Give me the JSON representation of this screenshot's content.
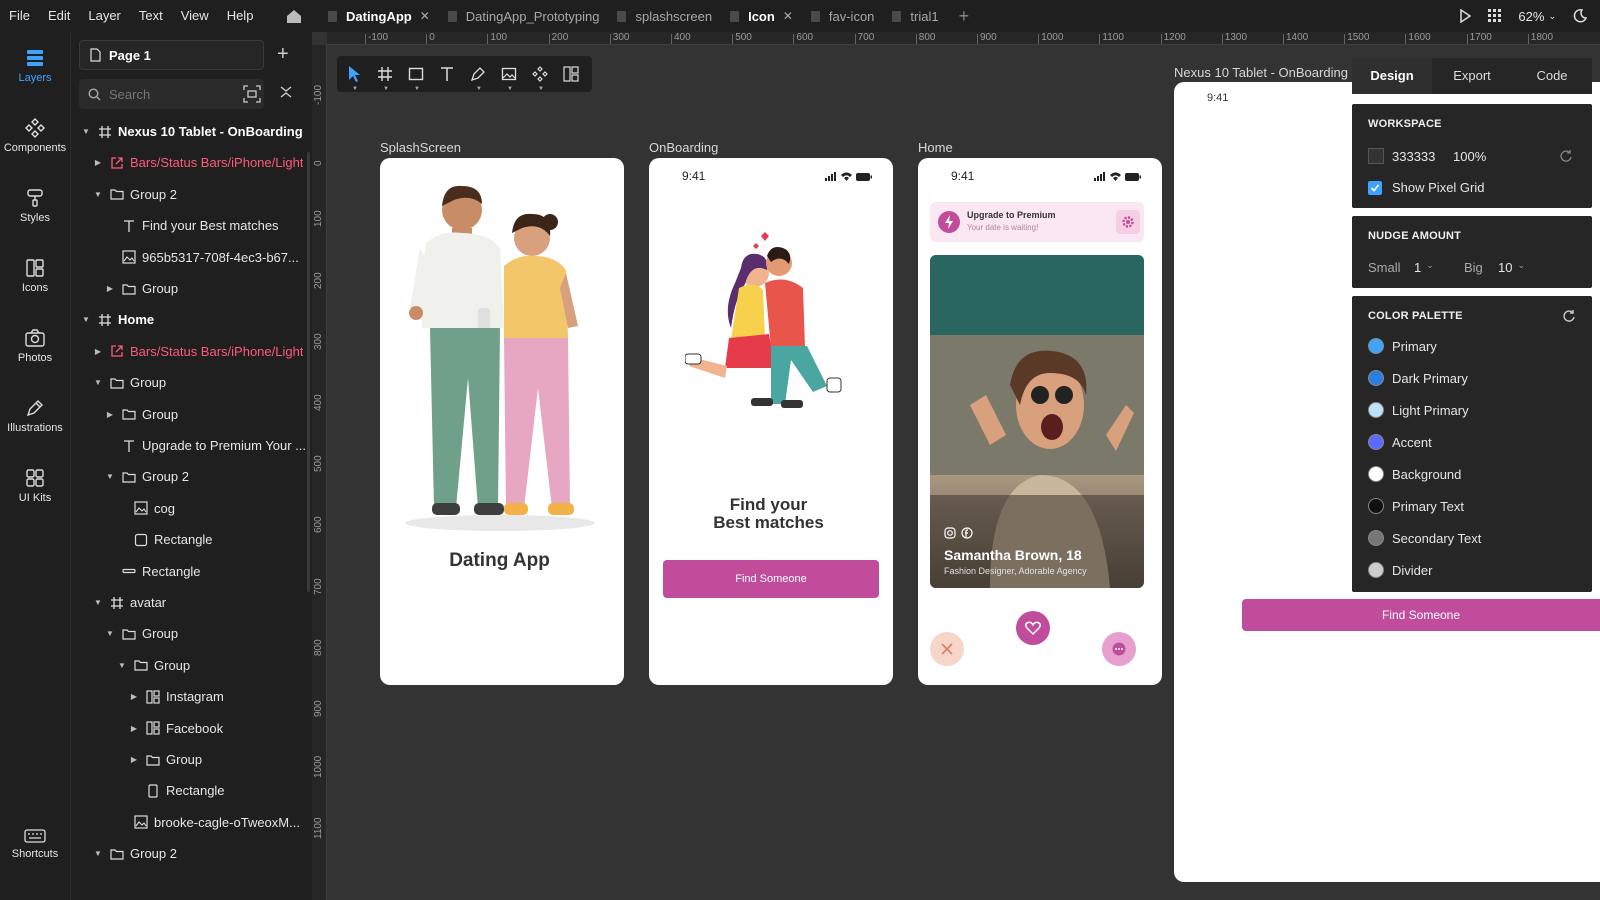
{
  "menu": [
    "File",
    "Edit",
    "Layer",
    "Text",
    "View",
    "Help"
  ],
  "tabs": [
    {
      "label": "DatingApp",
      "active": true,
      "closable": true
    },
    {
      "label": "DatingApp_Prototyping",
      "active": false,
      "closable": false
    },
    {
      "label": "splashscreen",
      "active": false,
      "closable": false
    },
    {
      "label": "Icon",
      "active": true,
      "closable": true
    },
    {
      "label": "fav-icon",
      "active": false,
      "closable": false
    },
    {
      "label": "trial1",
      "active": false,
      "closable": false
    }
  ],
  "zoom": "62%",
  "nav": [
    {
      "label": "Layers",
      "icon": "layers-icon"
    },
    {
      "label": "Components",
      "icon": "components-icon"
    },
    {
      "label": "Styles",
      "icon": "styles-icon"
    },
    {
      "label": "Icons",
      "icon": "icons-icon"
    },
    {
      "label": "Photos",
      "icon": "photos-icon"
    },
    {
      "label": "Illustrations",
      "icon": "illustrations-icon"
    },
    {
      "label": "UI Kits",
      "icon": "ui-kits-icon"
    }
  ],
  "shortcuts_label": "Shortcuts",
  "page_name": "Page 1",
  "search_placeholder": "Search",
  "layers": [
    {
      "name": "Nexus 10 Tablet - OnBoarding",
      "type": "frame",
      "depth": 0,
      "caret": "down"
    },
    {
      "name": "Bars/Status Bars/iPhone/Light",
      "type": "component",
      "depth": 1,
      "caret": "right"
    },
    {
      "name": "Group 2",
      "type": "group",
      "depth": 1,
      "caret": "down"
    },
    {
      "name": "Find your Best matches",
      "type": "text",
      "depth": 2,
      "caret": ""
    },
    {
      "name": "965b5317-708f-4ec3-b67...",
      "type": "image",
      "depth": 2,
      "caret": ""
    },
    {
      "name": "Group",
      "type": "group",
      "depth": 2,
      "caret": "right"
    },
    {
      "name": "Home",
      "type": "frame",
      "depth": 0,
      "caret": "down"
    },
    {
      "name": "Bars/Status Bars/iPhone/Light",
      "type": "component",
      "depth": 1,
      "caret": "right"
    },
    {
      "name": "Group",
      "type": "group",
      "depth": 1,
      "caret": "down"
    },
    {
      "name": "Group",
      "type": "group",
      "depth": 2,
      "caret": "right"
    },
    {
      "name": "Upgrade to Premium Your ...",
      "type": "text",
      "depth": 2,
      "caret": ""
    },
    {
      "name": "Group 2",
      "type": "group",
      "depth": 2,
      "caret": "down"
    },
    {
      "name": "cog",
      "type": "image",
      "depth": 3,
      "caret": ""
    },
    {
      "name": "Rectangle",
      "type": "rect",
      "depth": 3,
      "caret": ""
    },
    {
      "name": "Rectangle",
      "type": "line",
      "depth": 2,
      "caret": ""
    },
    {
      "name": "avatar",
      "type": "frame-normal",
      "depth": 1,
      "caret": "down"
    },
    {
      "name": "Group",
      "type": "group",
      "depth": 2,
      "caret": "down"
    },
    {
      "name": "Group",
      "type": "group",
      "depth": 3,
      "caret": "down"
    },
    {
      "name": "Instagram",
      "type": "component-normal",
      "depth": 4,
      "caret": "right"
    },
    {
      "name": "Facebook",
      "type": "component-normal",
      "depth": 4,
      "caret": "right"
    },
    {
      "name": "Group",
      "type": "group",
      "depth": 4,
      "caret": "right"
    },
    {
      "name": "Rectangle",
      "type": "rect-tall",
      "depth": 4,
      "caret": ""
    },
    {
      "name": "brooke-cagle-oTweoxM...",
      "type": "image",
      "depth": 3,
      "caret": ""
    },
    {
      "name": "Group 2",
      "type": "group",
      "depth": 1,
      "caret": "down"
    }
  ],
  "ruler_top": [
    "-100",
    "0",
    "100",
    "200",
    "300",
    "400",
    "500",
    "600",
    "700",
    "800",
    "900",
    "1000",
    "1100",
    "1200",
    "1300",
    "1400",
    "1500",
    "1600",
    "1700",
    "1800"
  ],
  "ruler_left": [
    "-100",
    "0",
    "100",
    "200",
    "300",
    "400",
    "500",
    "600",
    "700",
    "800",
    "900",
    "1000",
    "1100"
  ],
  "frames": {
    "splash": {
      "label": "SplashScreen",
      "title": "Dating App"
    },
    "onboarding": {
      "label": "OnBoarding",
      "time": "9:41",
      "title_line1": "Find your",
      "title_line2": "Best matches",
      "button": "Find Someone"
    },
    "home": {
      "label": "Home",
      "time": "9:41",
      "upgrade_title": "Upgrade to Premium",
      "upgrade_sub": "Your date is waiting!",
      "person_name": "Samantha Brown, 18",
      "person_sub": "Fashion Designer, Adorable Agency"
    },
    "tablet": {
      "label": "Nexus 10 Tablet - OnBoarding",
      "time": "9:41",
      "button": "Find Someone"
    }
  },
  "inspector": {
    "tabs": [
      "Design",
      "Export",
      "Code"
    ],
    "workspace": {
      "title": "WORKSPACE",
      "color": "333333",
      "opacity": "100%",
      "pixel_grid_label": "Show Pixel Grid"
    },
    "nudge": {
      "title": "NUDGE AMOUNT",
      "small_label": "Small",
      "small_value": "1",
      "big_label": "Big",
      "big_value": "10"
    },
    "palette": {
      "title": "COLOR PALETTE",
      "items": [
        {
          "name": "Primary",
          "color": "#3da3ff"
        },
        {
          "name": "Dark Primary",
          "color": "#2b7fe0"
        },
        {
          "name": "Light Primary",
          "color": "#bfe0ff"
        },
        {
          "name": "Accent",
          "color": "#5a6cff"
        },
        {
          "name": "Background",
          "color": "#ffffff"
        },
        {
          "name": "Primary Text",
          "color": "#111111"
        },
        {
          "name": "Secondary Text",
          "color": "#777777"
        },
        {
          "name": "Divider",
          "color": "#cccccc"
        }
      ]
    }
  },
  "colors": {
    "accent_pink": "#c24c9c",
    "ui_blue": "#3da3ff",
    "canvas": "#333333",
    "panel": "#1f1f1f"
  }
}
